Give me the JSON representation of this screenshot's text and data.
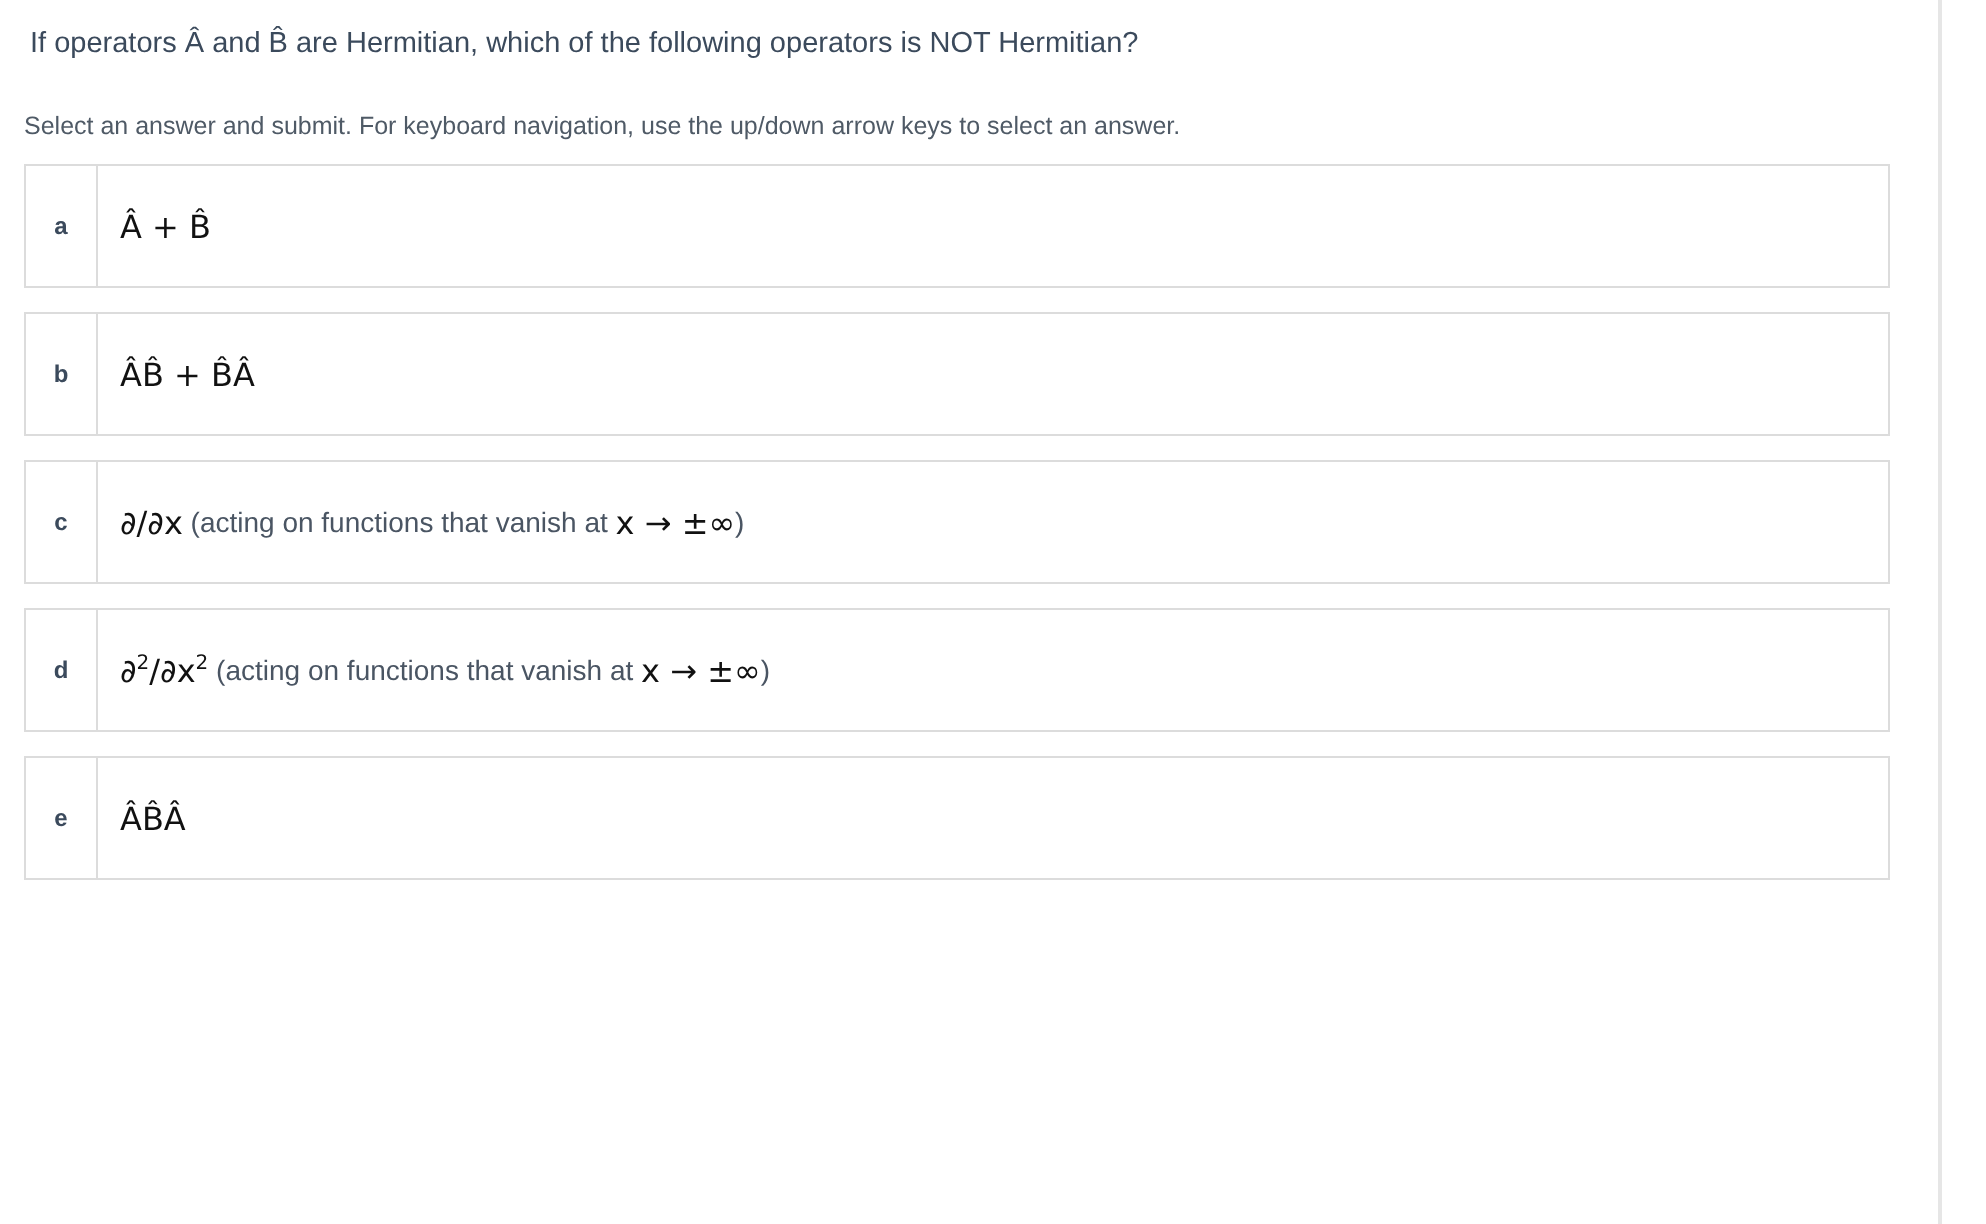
{
  "question": "If operators Â and B̂ are Hermitian, which of the following operators is NOT Hermitian?",
  "instructions": "Select an answer and submit. For keyboard navigation, use the up/down arrow keys to select an answer.",
  "options": [
    {
      "letter": "a",
      "selected": false,
      "parts": [
        {
          "kind": "math",
          "text": "Â + B̂"
        }
      ]
    },
    {
      "letter": "b",
      "selected": false,
      "parts": [
        {
          "kind": "math",
          "text": "ÂB̂ + B̂Â"
        }
      ]
    },
    {
      "letter": "c",
      "selected": false,
      "parts": [
        {
          "kind": "math",
          "text": "∂/∂x"
        },
        {
          "kind": "text",
          "text": " (acting on functions that vanish at "
        },
        {
          "kind": "math",
          "text": "x → ±∞"
        },
        {
          "kind": "text",
          "text": ")"
        }
      ]
    },
    {
      "letter": "d",
      "selected": false,
      "parts": [
        {
          "kind": "math",
          "text": "∂$^{2}$/∂x$^{2}$"
        },
        {
          "kind": "text",
          "text": " (acting on functions that vanish at "
        },
        {
          "kind": "math",
          "text": "x → ±∞"
        },
        {
          "kind": "text",
          "text": ")"
        }
      ]
    },
    {
      "letter": "e",
      "selected": false,
      "parts": [
        {
          "kind": "math",
          "text": "ÂB̂Â"
        }
      ]
    }
  ]
}
